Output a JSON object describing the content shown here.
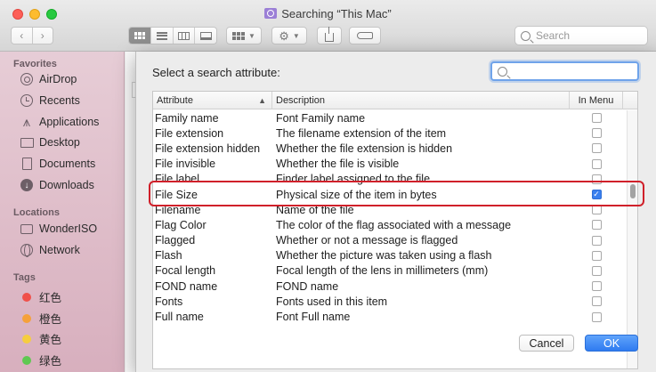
{
  "window": {
    "title": "Searching “This Mac”"
  },
  "toolbar": {
    "back_glyph": "‹",
    "forward_glyph": "›",
    "search_placeholder": "Search"
  },
  "sidebar": {
    "favorites_header": "Favorites",
    "favorites": [
      {
        "label": "AirDrop",
        "icon": "airdrop-icon"
      },
      {
        "label": "Recents",
        "icon": "clock-icon"
      },
      {
        "label": "Applications",
        "icon": "applications-icon"
      },
      {
        "label": "Desktop",
        "icon": "desktop-icon"
      },
      {
        "label": "Documents",
        "icon": "document-icon"
      },
      {
        "label": "Downloads",
        "icon": "download-icon"
      }
    ],
    "locations_header": "Locations",
    "locations": [
      {
        "label": "WonderISO",
        "icon": "disk-icon"
      },
      {
        "label": "Network",
        "icon": "globe-icon"
      }
    ],
    "tags_header": "Tags",
    "tags": [
      {
        "label": "红色",
        "color": "#f0504a"
      },
      {
        "label": "橙色",
        "color": "#f5a13a"
      },
      {
        "label": "黄色",
        "color": "#f6cd3f"
      },
      {
        "label": "绿色",
        "color": "#5fc851"
      }
    ]
  },
  "dialog": {
    "title": "Select a search attribute:",
    "search_value": "",
    "columns": {
      "attribute": "Attribute",
      "description": "Description",
      "in_menu": "In Menu"
    },
    "rows": [
      {
        "attribute": "Family name",
        "description": "Font Family name",
        "in_menu": false
      },
      {
        "attribute": "File extension",
        "description": "The filename extension of the item",
        "in_menu": false
      },
      {
        "attribute": "File extension hidden",
        "description": "Whether the file extension is hidden",
        "in_menu": false
      },
      {
        "attribute": "File invisible",
        "description": "Whether the file is visible",
        "in_menu": false
      },
      {
        "attribute": "File label",
        "description": "Finder label assigned to the file",
        "in_menu": false
      },
      {
        "attribute": "File Size",
        "description": "Physical size of the item in bytes",
        "in_menu": true
      },
      {
        "attribute": "Filename",
        "description": "Name of the file",
        "in_menu": false
      },
      {
        "attribute": "Flag Color",
        "description": "The color of the flag associated with a message",
        "in_menu": false
      },
      {
        "attribute": "Flagged",
        "description": "Whether or not a message is flagged",
        "in_menu": false
      },
      {
        "attribute": "Flash",
        "description": "Whether the picture was taken using a flash",
        "in_menu": false
      },
      {
        "attribute": "Focal length",
        "description": "Focal length of the lens in millimeters (mm)",
        "in_menu": false
      },
      {
        "attribute": "FOND name",
        "description": "FOND name",
        "in_menu": false
      },
      {
        "attribute": "Fonts",
        "description": "Fonts used in this item",
        "in_menu": false
      },
      {
        "attribute": "Full name",
        "description": "Font Full name",
        "in_menu": false
      }
    ],
    "cancel_label": "Cancel",
    "ok_label": "OK"
  },
  "colors": {
    "accent": "#3a80ef",
    "highlight_border": "#d0202a"
  }
}
